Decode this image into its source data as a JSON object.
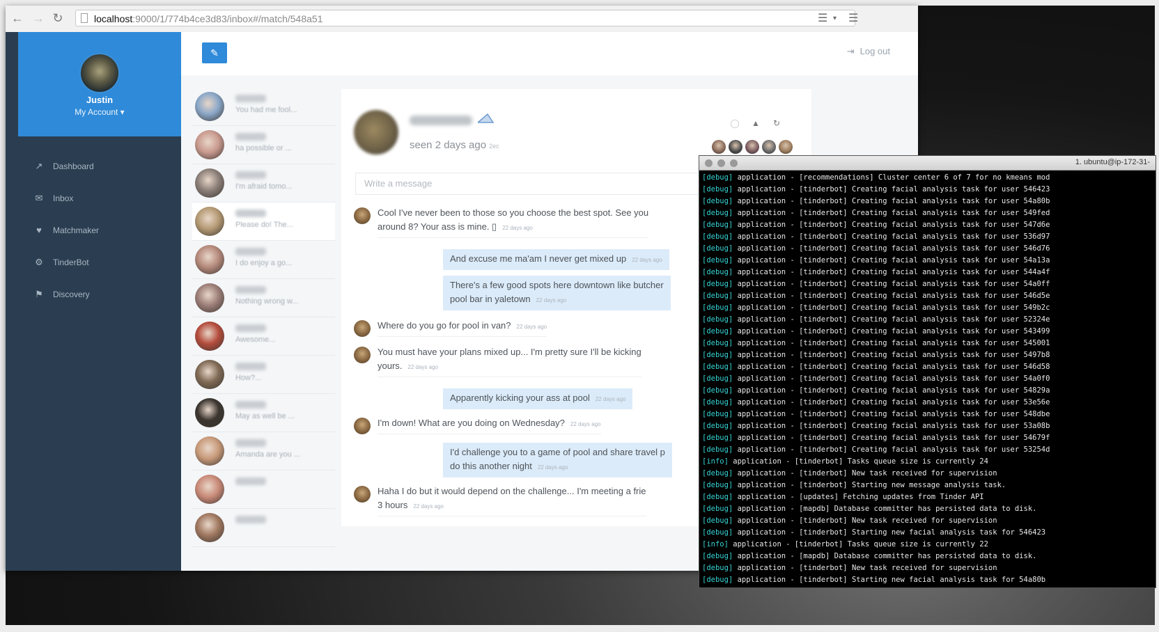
{
  "browser": {
    "url_host": "localhost",
    "url_path": ":9000/1/774b4ce3d83/inbox#/match/548a51"
  },
  "user": {
    "name": "Justin",
    "account_label": "My Account ▾"
  },
  "nav": [
    {
      "label": "Dashboard",
      "icon": "dashboard-icon"
    },
    {
      "label": "Inbox",
      "icon": "inbox-icon"
    },
    {
      "label": "Matchmaker",
      "icon": "matchmaker-icon"
    },
    {
      "label": "TinderBot",
      "icon": "robot-icon"
    },
    {
      "label": "Discovery",
      "icon": "discovery-icon"
    }
  ],
  "topbar": {
    "compose_icon": "compose-icon",
    "logout_label": "Log out"
  },
  "conversations": [
    {
      "preview": "You had me fool...",
      "color": "#8aa7c8"
    },
    {
      "preview": "ha possible or ...",
      "color": "#c99a8f"
    },
    {
      "preview": "I'm afraid tomo...",
      "color": "#8b7f78"
    },
    {
      "preview": "Please do! The...",
      "color": "#b59a74"
    },
    {
      "preview": "I do enjoy a go...",
      "color": "#b58a7c"
    },
    {
      "preview": "Nothing wrong w...",
      "color": "#9c7e78"
    },
    {
      "preview": "Awesome...",
      "color": "#b44c3c"
    },
    {
      "preview": "How?...",
      "color": "#7f6a55"
    },
    {
      "preview": "May as well be ...",
      "color": "#3b3530"
    },
    {
      "preview": "Amanda are you ...",
      "color": "#c89a7a"
    },
    {
      "preview": "",
      "color": "#c98a78"
    },
    {
      "preview": "",
      "color": "#a07860"
    }
  ],
  "chat": {
    "seen": "seen 2 days ago",
    "seen_suffix": "2ec",
    "message_placeholder": "Write a message",
    "timestamp": "22 days ago",
    "messages": [
      {
        "dir": "in",
        "lines": [
          "Cool I've never been to those so you choose the best spot. See you",
          "around 8? Your ass is mine. ▯"
        ]
      },
      {
        "dir": "out",
        "lines": [
          "And excuse me ma'am I never get mixed up"
        ]
      },
      {
        "dir": "out",
        "lines": [
          "There's a few good spots here downtown like butcher",
          "pool bar in yaletown"
        ]
      },
      {
        "dir": "in",
        "lines": [
          "Where do you go for pool in van?"
        ]
      },
      {
        "dir": "in",
        "lines": [
          "You must have your plans mixed up... I'm pretty sure I'll be kicking",
          "yours."
        ]
      },
      {
        "dir": "out",
        "lines": [
          "Apparently kicking your ass at pool"
        ]
      },
      {
        "dir": "in",
        "lines": [
          "I'm down! What are you doing on Wednesday?"
        ]
      },
      {
        "dir": "out",
        "lines": [
          "I'd challenge you to a game of pool and share travel p",
          "do this another night"
        ]
      },
      {
        "dir": "in",
        "lines": [
          "Haha I do but it would depend on the challenge... I'm meeting a frie",
          "3 hours"
        ]
      }
    ],
    "face_colors": [
      "#8a6a5a",
      "#4b4b4b",
      "#7a5a60",
      "#6a6a6a",
      "#9a7a5a"
    ]
  },
  "terminal": {
    "title": "1. ubuntu@ip-172-31-",
    "lines": [
      {
        "level": "[debug]",
        "text": "application - [recommendations] Cluster center 6 of 7 for no kmeans mod"
      },
      {
        "level": "[debug]",
        "text": "application - [tinderbot] Creating facial analysis task for user 546423"
      },
      {
        "level": "[debug]",
        "text": "application - [tinderbot] Creating facial analysis task for user 54a80b"
      },
      {
        "level": "[debug]",
        "text": "application - [tinderbot] Creating facial analysis task for user 549fed"
      },
      {
        "level": "[debug]",
        "text": "application - [tinderbot] Creating facial analysis task for user 547d6e"
      },
      {
        "level": "[debug]",
        "text": "application - [tinderbot] Creating facial analysis task for user 536d97"
      },
      {
        "level": "[debug]",
        "text": "application - [tinderbot] Creating facial analysis task for user 546d76"
      },
      {
        "level": "[debug]",
        "text": "application - [tinderbot] Creating facial analysis task for user 54a13a"
      },
      {
        "level": "[debug]",
        "text": "application - [tinderbot] Creating facial analysis task for user 544a4f"
      },
      {
        "level": "[debug]",
        "text": "application - [tinderbot] Creating facial analysis task for user 54a0ff"
      },
      {
        "level": "[debug]",
        "text": "application - [tinderbot] Creating facial analysis task for user 546d5e"
      },
      {
        "level": "[debug]",
        "text": "application - [tinderbot] Creating facial analysis task for user 549b2c"
      },
      {
        "level": "[debug]",
        "text": "application - [tinderbot] Creating facial analysis task for user 52324e"
      },
      {
        "level": "[debug]",
        "text": "application - [tinderbot] Creating facial analysis task for user 543499"
      },
      {
        "level": "[debug]",
        "text": "application - [tinderbot] Creating facial analysis task for user 545001"
      },
      {
        "level": "[debug]",
        "text": "application - [tinderbot] Creating facial analysis task for user 5497b8"
      },
      {
        "level": "[debug]",
        "text": "application - [tinderbot] Creating facial analysis task for user 546d58"
      },
      {
        "level": "[debug]",
        "text": "application - [tinderbot] Creating facial analysis task for user 54a0f0"
      },
      {
        "level": "[debug]",
        "text": "application - [tinderbot] Creating facial analysis task for user 54829a"
      },
      {
        "level": "[debug]",
        "text": "application - [tinderbot] Creating facial analysis task for user 53e56e"
      },
      {
        "level": "[debug]",
        "text": "application - [tinderbot] Creating facial analysis task for user 548dbe"
      },
      {
        "level": "[debug]",
        "text": "application - [tinderbot] Creating facial analysis task for user 53a08b"
      },
      {
        "level": "[debug]",
        "text": "application - [tinderbot] Creating facial analysis task for user 54679f"
      },
      {
        "level": "[debug]",
        "text": "application - [tinderbot] Creating facial analysis task for user 53254d"
      },
      {
        "level": "[info]",
        "text": "application - [tinderbot] Tasks queue size is currently 24"
      },
      {
        "level": "[debug]",
        "text": "application - [tinderbot] New task received for supervision"
      },
      {
        "level": "[debug]",
        "text": "application - [tinderbot] Starting new message analysis task."
      },
      {
        "level": "[debug]",
        "text": "application - [updates] Fetching updates from Tinder API"
      },
      {
        "level": "[debug]",
        "text": "application - [mapdb] Database committer has persisted data to disk."
      },
      {
        "level": "[debug]",
        "text": "application - [tinderbot] New task received for supervision"
      },
      {
        "level": "[debug]",
        "text": "application - [tinderbot] Starting new facial analysis task for 546423"
      },
      {
        "level": "[info]",
        "text": "application - [tinderbot] Tasks queue size is currently 22"
      },
      {
        "level": "[debug]",
        "text": "application - [mapdb] Database committer has persisted data to disk."
      },
      {
        "level": "[debug]",
        "text": "application - [tinderbot] New task received for supervision"
      },
      {
        "level": "[debug]",
        "text": "application - [tinderbot] Starting new facial analysis task for 54a80b"
      }
    ]
  },
  "colors": {
    "sidebar": "#2b3e51",
    "accent": "#2f8ad9",
    "bubble_out": "#dcebf9",
    "log_level": "#37d4d4"
  }
}
